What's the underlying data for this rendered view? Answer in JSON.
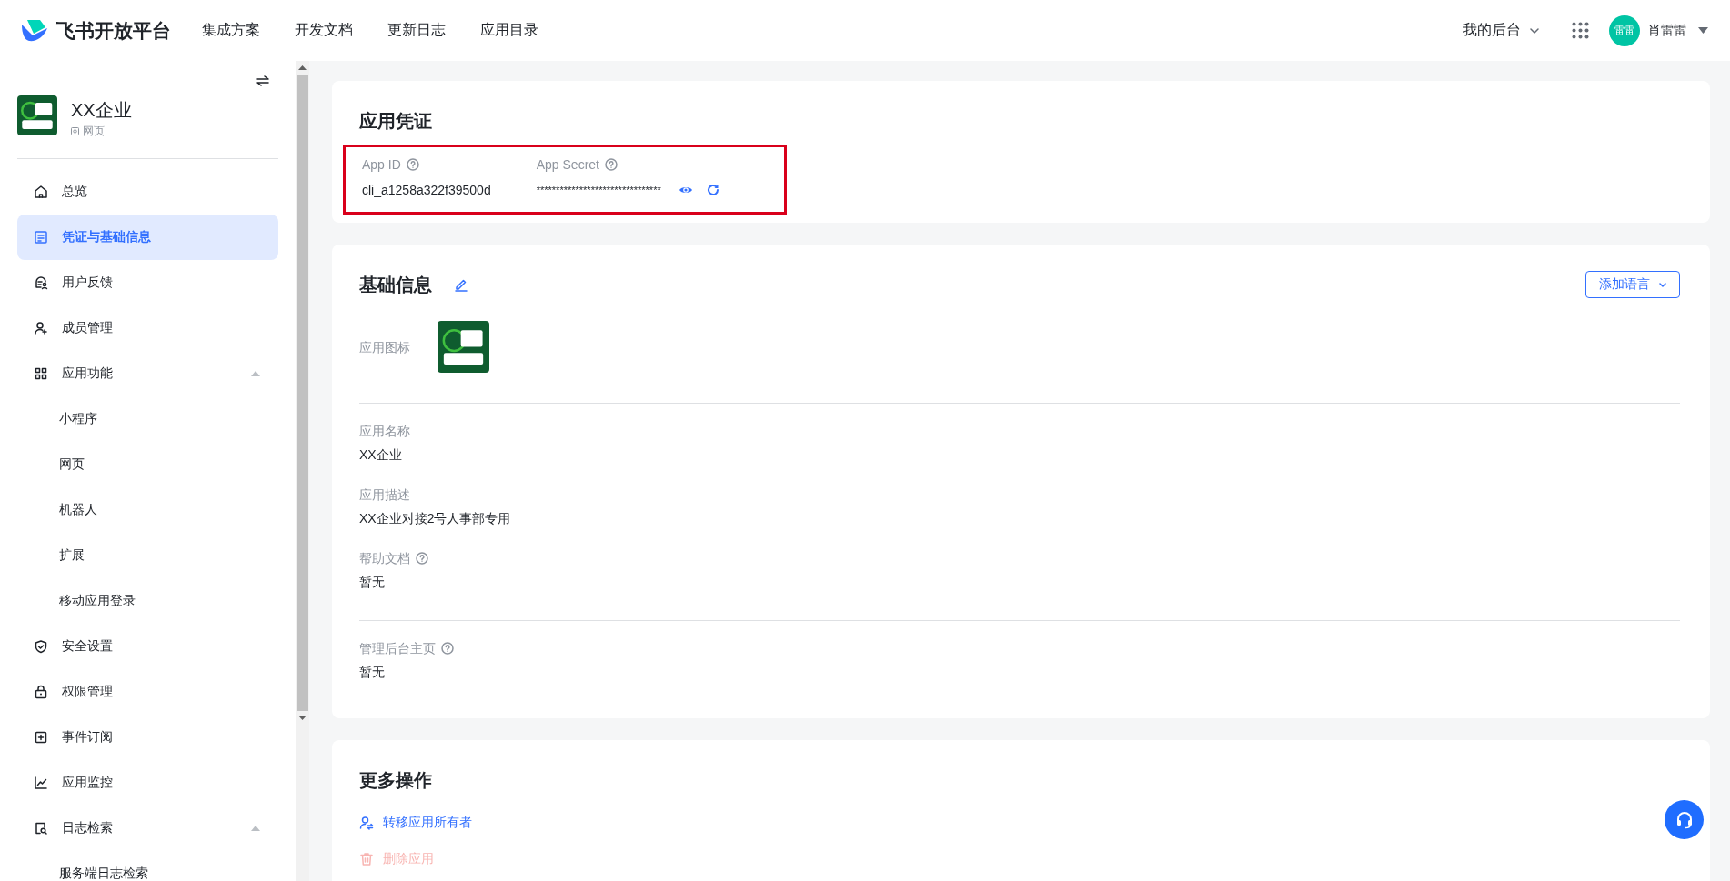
{
  "header": {
    "brand": "飞书开放平台",
    "nav": [
      {
        "label": "集成方案"
      },
      {
        "label": "开发文档"
      },
      {
        "label": "更新日志"
      },
      {
        "label": "应用目录"
      }
    ],
    "console": "我的后台",
    "user": {
      "avatar_text": "雷雷",
      "name": "肖雷雷"
    }
  },
  "sidebar": {
    "app": {
      "name": "XX企业",
      "type": "网页"
    },
    "items": [
      {
        "label": "总览",
        "selected": false
      },
      {
        "label": "凭证与基础信息",
        "selected": true
      },
      {
        "label": "用户反馈",
        "selected": false
      },
      {
        "label": "成员管理",
        "selected": false
      },
      {
        "label": "应用功能",
        "selected": false,
        "expanded": true,
        "children": [
          {
            "label": "小程序",
            "selected": false
          },
          {
            "label": "网页",
            "selected": false
          },
          {
            "label": "机器人",
            "selected": false
          },
          {
            "label": "扩展",
            "selected": false
          },
          {
            "label": "移动应用登录",
            "selected": false
          }
        ]
      },
      {
        "label": "安全设置",
        "selected": false
      },
      {
        "label": "权限管理",
        "selected": false
      },
      {
        "label": "事件订阅",
        "selected": false
      },
      {
        "label": "应用监控",
        "selected": false
      },
      {
        "label": "日志检索",
        "selected": false,
        "expanded": true,
        "children": [
          {
            "label": "服务端日志检索",
            "selected": false
          }
        ]
      }
    ]
  },
  "credentials": {
    "title": "应用凭证",
    "highlighted": true,
    "fields": [
      {
        "label": "App ID",
        "value": "cli_a1258a322f39500d",
        "kind": "id"
      },
      {
        "label": "App Secret",
        "value": "********************************",
        "kind": "secret"
      }
    ]
  },
  "basic_info": {
    "title": "基础信息",
    "button": "添加语言",
    "sections": [
      [
        {
          "label": "应用图标",
          "kind": "icon",
          "help": false
        }
      ],
      [
        {
          "label": "应用名称",
          "value": "XX企业",
          "kind": "text",
          "help": false
        },
        {
          "label": "应用描述",
          "value": "XX企业对接2号人事部专用",
          "kind": "text",
          "help": false
        },
        {
          "label": "帮助文档",
          "value": "暂无",
          "kind": "text",
          "help": true
        }
      ],
      [
        {
          "label": "管理后台主页",
          "value": "暂无",
          "kind": "text",
          "help": true
        }
      ]
    ]
  },
  "more_actions": {
    "title": "更多操作",
    "actions": [
      {
        "label": "转移应用所有者",
        "kind": "transfer",
        "disabled": false
      },
      {
        "label": "删除应用",
        "kind": "delete",
        "disabled": true
      }
    ]
  }
}
